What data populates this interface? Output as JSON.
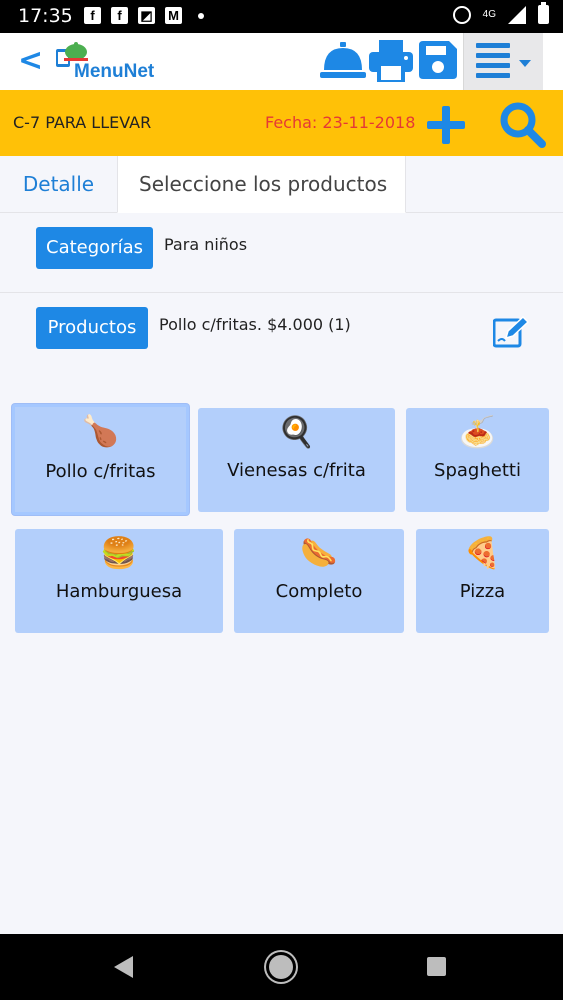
{
  "status_bar": {
    "time": "17:35",
    "network": "4G",
    "icons": [
      "facebook-icon",
      "facebook-icon",
      "image-icon",
      "gmail-icon",
      "alarm-icon",
      "signal-icon",
      "battery-icon"
    ]
  },
  "header": {
    "app_name": "MenuNet",
    "icons": [
      "back-icon",
      "service-bell-icon",
      "printer-icon",
      "save-icon",
      "menu-icon"
    ]
  },
  "order": {
    "name": "C-7 PARA LLEVAR",
    "date": "Fecha: 23-11-2018"
  },
  "tabs": [
    {
      "label": "Detalle"
    },
    {
      "label": "Seleccione los productos"
    }
  ],
  "category": {
    "button_label": "Categorías",
    "value": "Para niños"
  },
  "product": {
    "button_label": "Productos",
    "value": "Pollo c/fritas. $4.000 (1)"
  },
  "products": [
    {
      "label": "Pollo c/fritas",
      "icon": "roast-chicken-icon",
      "emoji": "🍗",
      "selected": true
    },
    {
      "label": "Vienesas c/frita",
      "icon": "breakfast-icon",
      "emoji": "🍳",
      "selected": false
    },
    {
      "label": "Spaghetti",
      "icon": "spaghetti-icon",
      "emoji": "🍝",
      "selected": false
    },
    {
      "label": "Hamburguesa",
      "icon": "hamburger-icon",
      "emoji": "🍔",
      "selected": false
    },
    {
      "label": "Completo",
      "icon": "hotdog-icon",
      "emoji": "🌭",
      "selected": false
    },
    {
      "label": "Pizza",
      "icon": "pizza-icon",
      "emoji": "🍕",
      "selected": false
    }
  ],
  "colors": {
    "accent": "#1e88e5",
    "order_bar": "#ffc107",
    "date_text": "#e53935",
    "card_bg": "#b3cffb"
  }
}
